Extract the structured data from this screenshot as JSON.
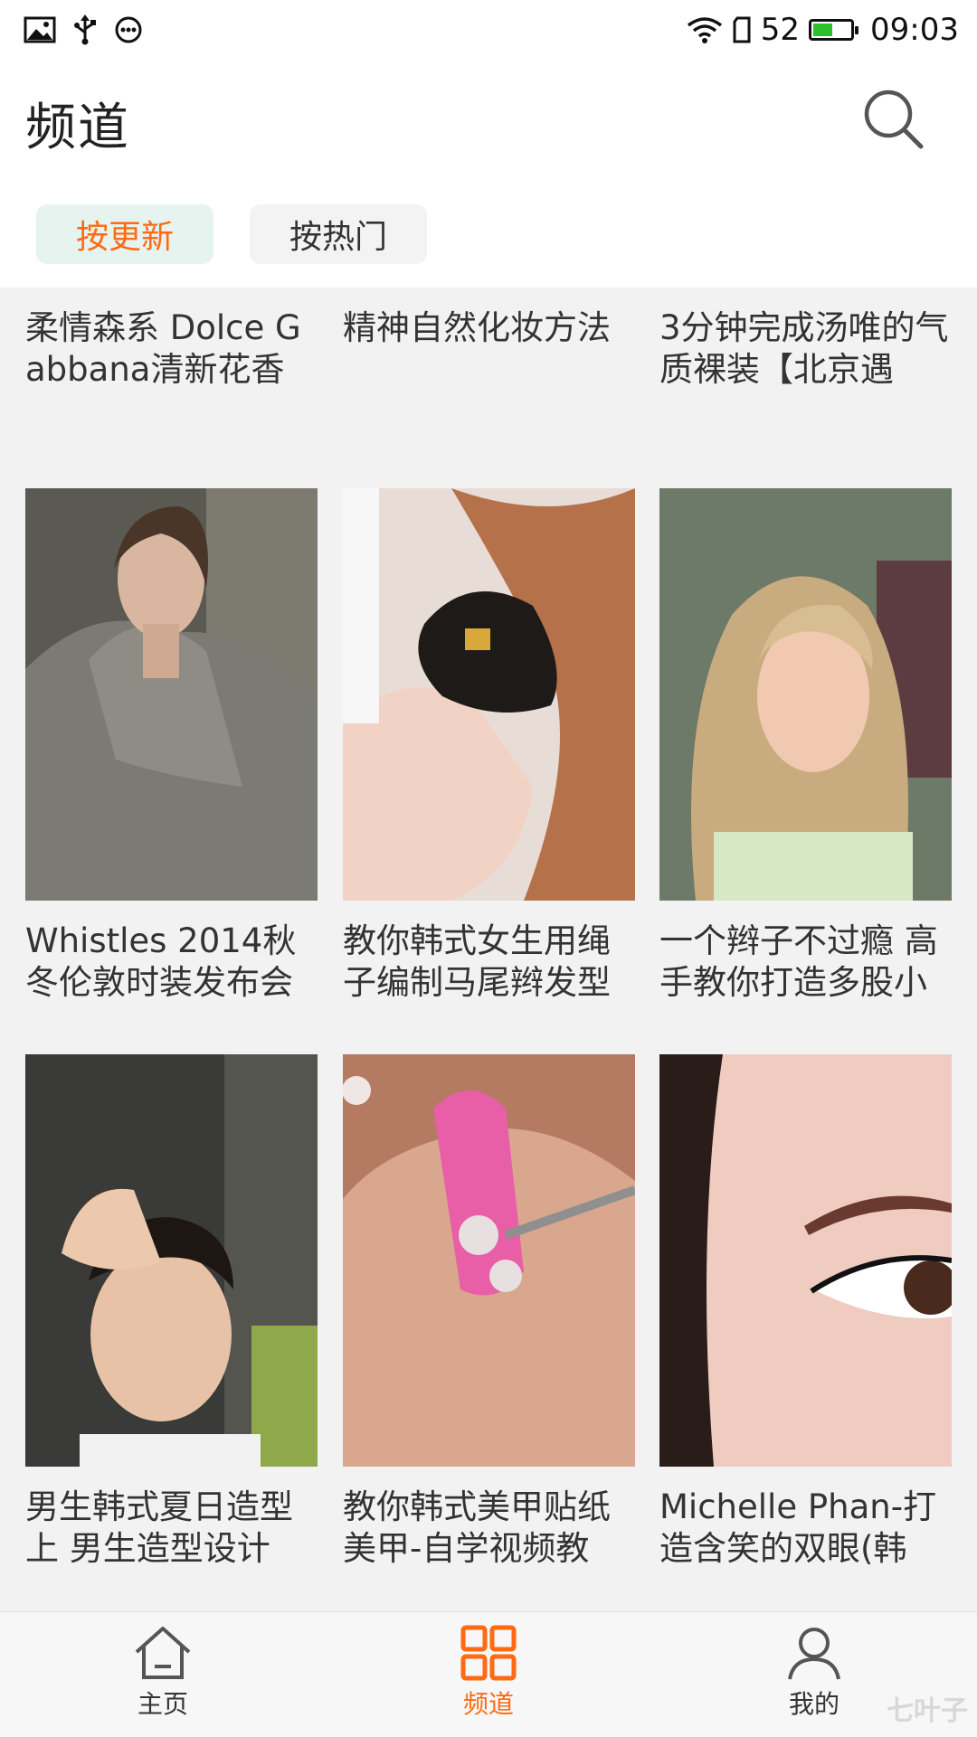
{
  "status_bar": {
    "battery_level": "52",
    "battery_fraction": 0.52,
    "time": "09:03",
    "icons_left": [
      "image-icon",
      "usb-icon",
      "more-dots-icon"
    ],
    "icons_right": [
      "wifi-icon",
      "sim-icon",
      "battery-icon"
    ]
  },
  "header": {
    "title": "频道",
    "search_icon": "search-icon"
  },
  "tabs": [
    {
      "label": "按更新",
      "active": true
    },
    {
      "label": "按热门",
      "active": false
    }
  ],
  "colors": {
    "accent": "#ff6a12",
    "active_tab_bg": "#e6f3ef",
    "battery_green": "#2cc02c"
  },
  "cards": [
    {
      "title": "柔情森系 Dolce Gabbana清新花香"
    },
    {
      "title": "精神自然化妆方法"
    },
    {
      "title": "3分钟完成汤唯的气质裸装【北京遇"
    },
    {
      "title": "Whistles 2014秋冬伦敦时装发布会"
    },
    {
      "title": "教你韩式女生用绳子编制马尾辫发型"
    },
    {
      "title": "一个辫子不过瘾 高手教你打造多股小"
    },
    {
      "title": "男生韩式夏日造型上 男生造型设计"
    },
    {
      "title": "教你韩式美甲贴纸美甲-自学视频教"
    },
    {
      "title": "Michelle Phan-打造含笑的双眼(韩"
    }
  ],
  "bottom_nav": [
    {
      "label": "主页",
      "icon": "home-icon",
      "active": false
    },
    {
      "label": "频道",
      "icon": "grid-icon",
      "active": true
    },
    {
      "label": "我的",
      "icon": "person-icon",
      "active": false
    }
  ],
  "watermark": "七叶子"
}
